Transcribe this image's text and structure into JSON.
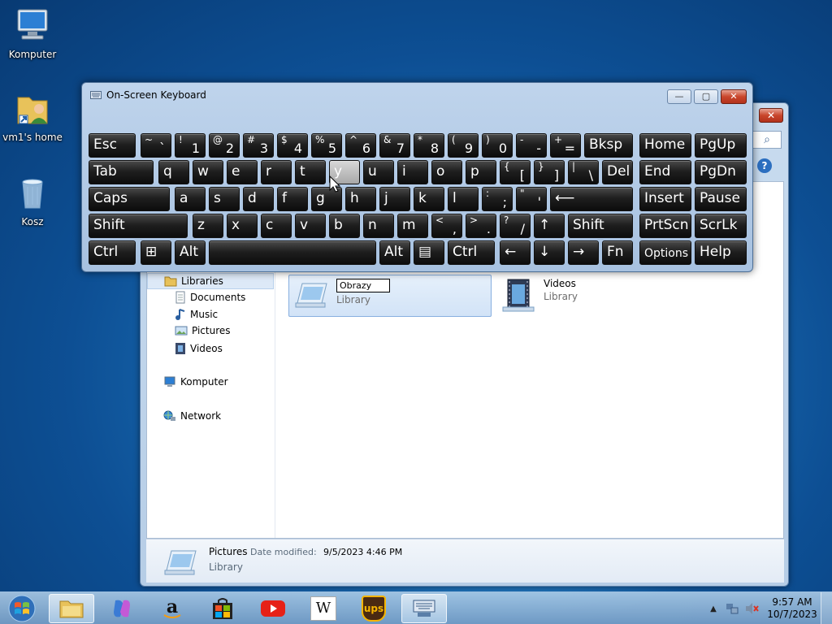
{
  "desktop": {
    "icons": [
      {
        "label": "Komputer"
      },
      {
        "label": "vm1's home"
      },
      {
        "label": "Kosz"
      }
    ]
  },
  "explorer": {
    "close_glyph": "✕",
    "search_glyph": "⌕",
    "help_glyph": "?",
    "nav": {
      "libraries": "Libraries",
      "documents": "Documents",
      "music": "Music",
      "pictures": "Pictures",
      "videos": "Videos",
      "computer": "Komputer",
      "network": "Network"
    },
    "tiles": [
      {
        "name": "Obrazy",
        "sub": "Library"
      },
      {
        "name": "Videos",
        "sub": "Library"
      }
    ],
    "details": {
      "name": "Pictures",
      "modified_label": "Date modified:",
      "modified_value": "9/5/2023 4:46 PM",
      "type": "Library"
    }
  },
  "osk": {
    "title": "On-Screen Keyboard",
    "rows": [
      [
        {
          "k": "Esc"
        },
        {
          "s": "~",
          "m": "`"
        },
        {
          "s": "!",
          "m": "1"
        },
        {
          "s": "@",
          "m": "2"
        },
        {
          "s": "#",
          "m": "3"
        },
        {
          "s": "$",
          "m": "4"
        },
        {
          "s": "%",
          "m": "5"
        },
        {
          "s": "^",
          "m": "6"
        },
        {
          "s": "&",
          "m": "7"
        },
        {
          "s": "*",
          "m": "8"
        },
        {
          "s": "(",
          "m": "9"
        },
        {
          "s": ")",
          "m": "0"
        },
        {
          "s": "-",
          "m": "-"
        },
        {
          "s": "+",
          "m": "="
        },
        {
          "k": "Bksp"
        },
        {
          "k": "Home"
        },
        {
          "k": "PgUp"
        }
      ],
      [
        {
          "k": "Tab"
        },
        {
          "k": "q"
        },
        {
          "k": "w"
        },
        {
          "k": "e"
        },
        {
          "k": "r"
        },
        {
          "k": "t"
        },
        {
          "k": "y"
        },
        {
          "k": "u"
        },
        {
          "k": "i"
        },
        {
          "k": "o"
        },
        {
          "k": "p"
        },
        {
          "s": "{",
          "m": "["
        },
        {
          "s": "}",
          "m": "]"
        },
        {
          "s": "|",
          "m": "\\"
        },
        {
          "k": "Del"
        },
        {
          "k": "End"
        },
        {
          "k": "PgDn"
        }
      ],
      [
        {
          "k": "Caps"
        },
        {
          "k": "a"
        },
        {
          "k": "s"
        },
        {
          "k": "d"
        },
        {
          "k": "f"
        },
        {
          "k": "g"
        },
        {
          "k": "h"
        },
        {
          "k": "j"
        },
        {
          "k": "k"
        },
        {
          "k": "l"
        },
        {
          "s": ":",
          "m": ";"
        },
        {
          "s": "\"",
          "m": "'"
        },
        {
          "k": "⟵"
        },
        {
          "k": "Insert"
        },
        {
          "k": "Pause"
        }
      ],
      [
        {
          "k": "Shift"
        },
        {
          "k": "z"
        },
        {
          "k": "x"
        },
        {
          "k": "c"
        },
        {
          "k": "v"
        },
        {
          "k": "b"
        },
        {
          "k": "n"
        },
        {
          "k": "m"
        },
        {
          "s": "<",
          "m": ","
        },
        {
          "s": ">",
          "m": "."
        },
        {
          "s": "?",
          "m": "/"
        },
        {
          "k": "↑"
        },
        {
          "k": "Shift"
        },
        {
          "k": "PrtScn"
        },
        {
          "k": "ScrLk"
        }
      ],
      [
        {
          "k": "Ctrl"
        },
        {
          "k": "⊞"
        },
        {
          "k": "Alt"
        },
        {
          "k": ""
        },
        {
          "k": "Alt"
        },
        {
          "k": "▤"
        },
        {
          "k": "Ctrl"
        },
        {
          "k": "←"
        },
        {
          "k": "↓"
        },
        {
          "k": "→"
        },
        {
          "k": "Fn"
        },
        {
          "k": "Options"
        },
        {
          "k": "Help"
        }
      ]
    ]
  },
  "taskbar": {
    "clock_time": "9:57 AM",
    "clock_date": "10/7/2023",
    "wiki_glyph": "W",
    "ups_glyph": "ups"
  }
}
